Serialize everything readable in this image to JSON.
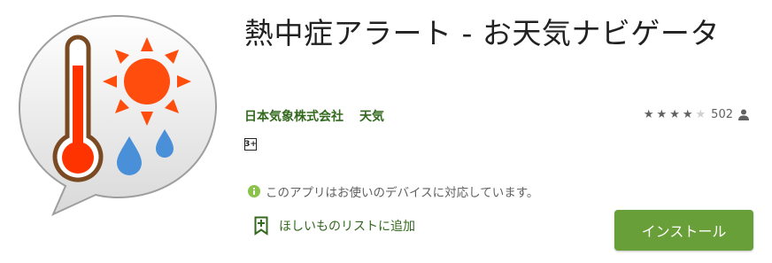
{
  "app": {
    "title": "熱中症アラート - お天気ナビゲータ",
    "developer": "日本気象株式会社",
    "category": "天気",
    "rating_count": "502",
    "rating_stars": 4,
    "rating_max": 5,
    "content_rating": "3+",
    "compatibility": "このアプリはお使いのデバイスに対応しています。",
    "wishlist_label": "ほしいものリストに追加",
    "install_label": "インストール"
  },
  "icons": {
    "app": "thermometer-sun-rain-speech-bubble-icon",
    "rating_person": "person-icon",
    "compatibility": "info-icon",
    "wishlist": "bookmark-plus-icon"
  },
  "colors": {
    "developer": "#33691e",
    "install_button": "#689f38",
    "compat_icon": "#8bc34a",
    "thermometer": "#ff3300",
    "sun": "#ff4d0d",
    "rain": "#4a90d9"
  }
}
